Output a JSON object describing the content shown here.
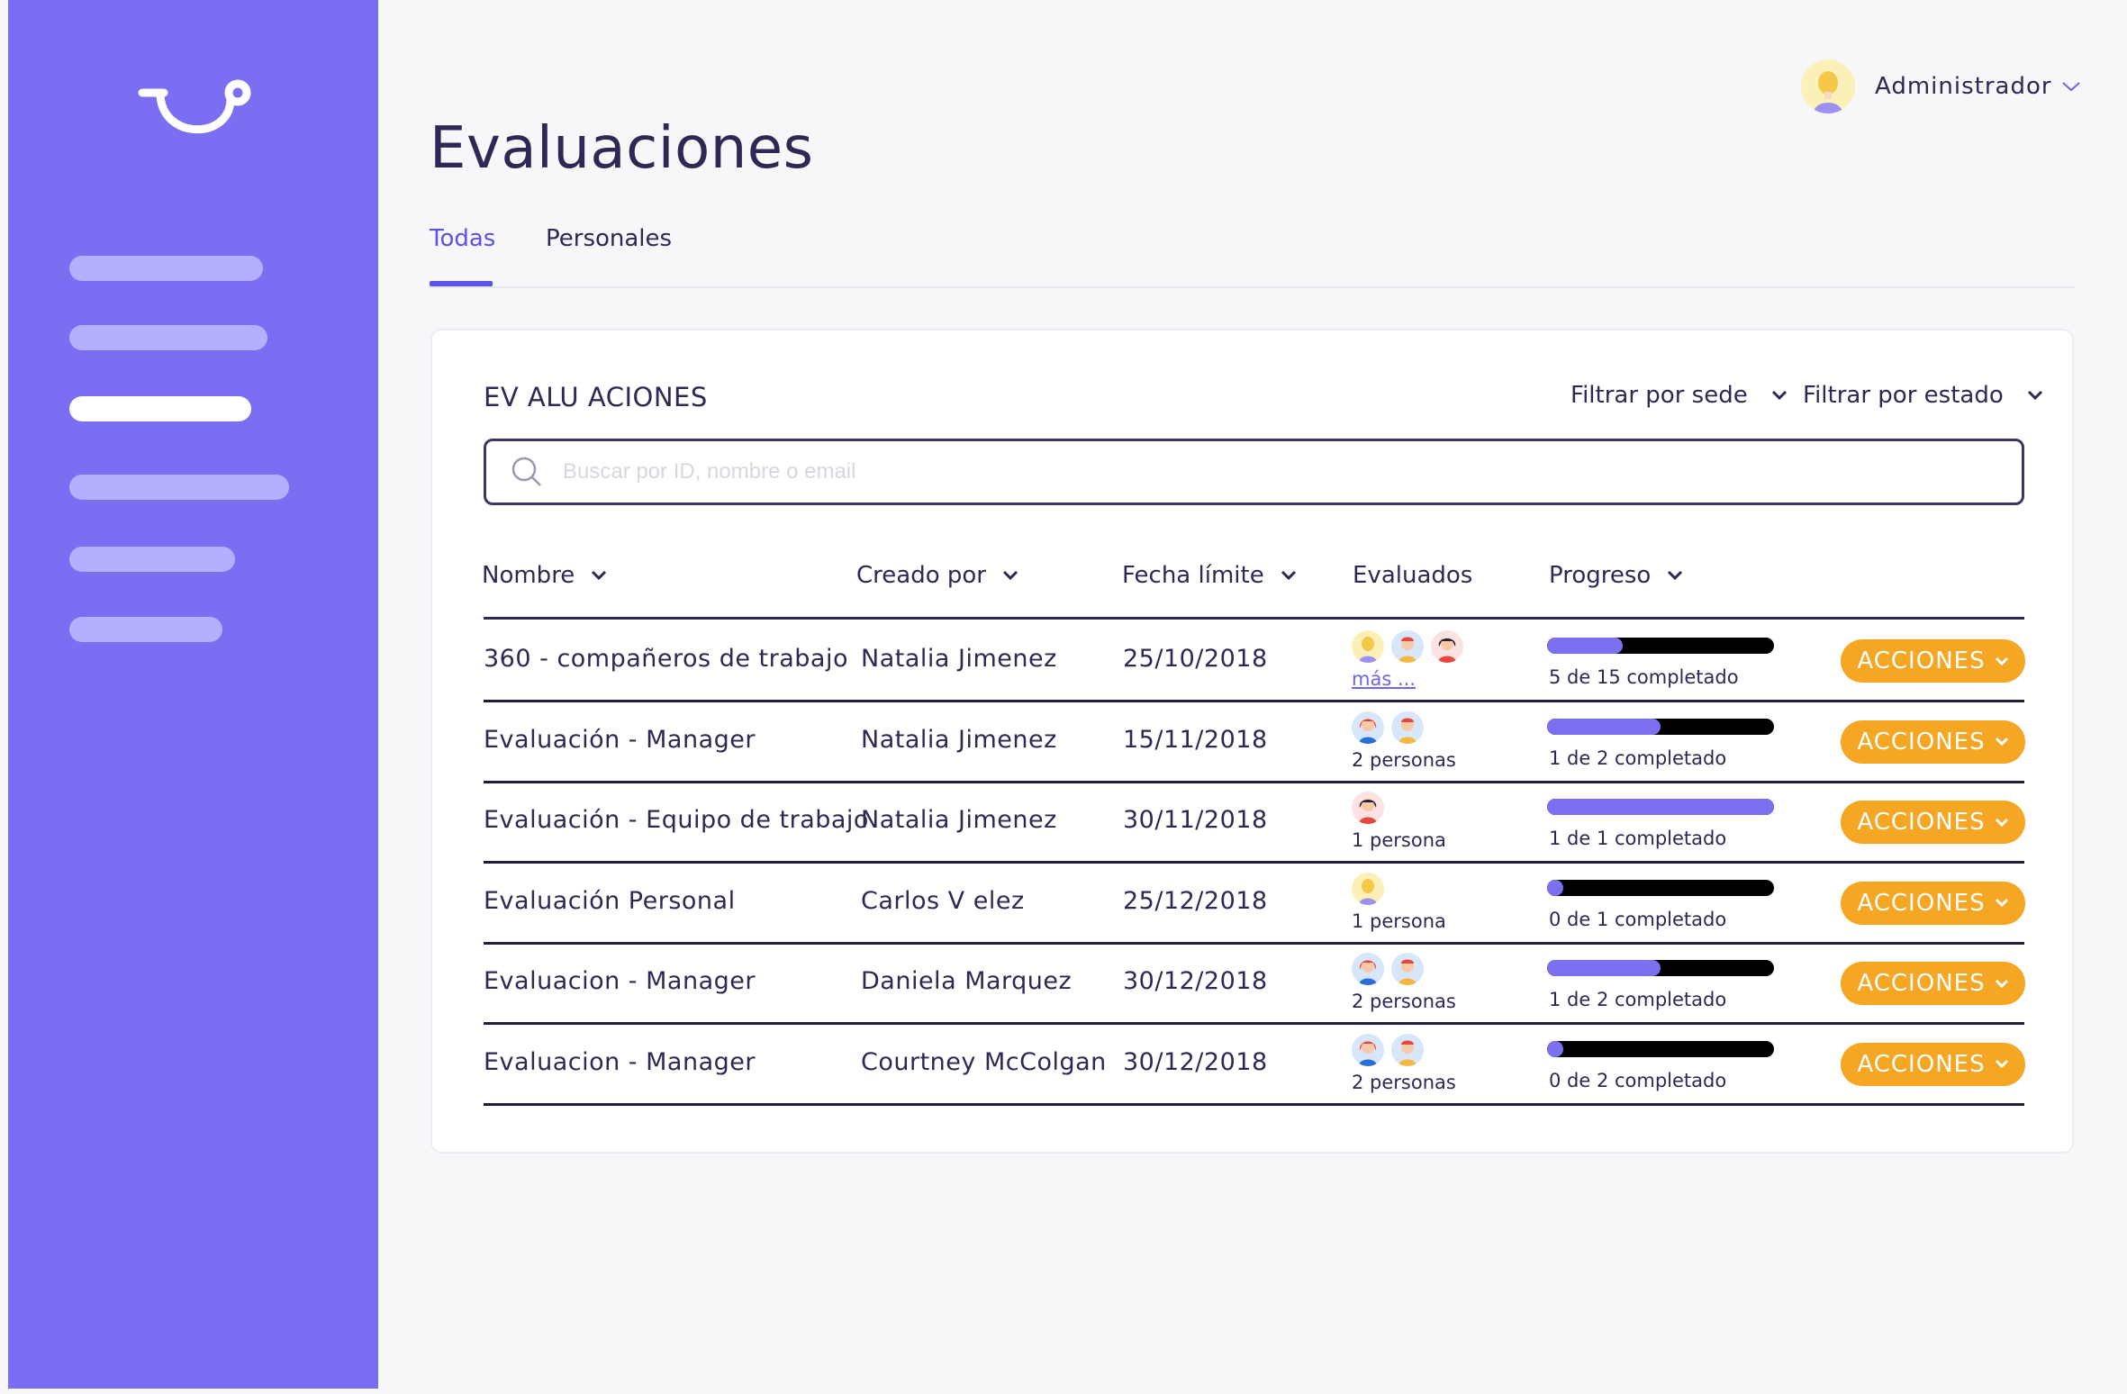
{
  "app": {
    "title": "Evaluaciones",
    "user_name": "Administrador"
  },
  "tabs": [
    {
      "label": "Todas",
      "active": true
    },
    {
      "label": "Personales",
      "active": false
    }
  ],
  "card": {
    "title": "EV ALU ACIONES",
    "filters": [
      "Filtrar por sede",
      "Filtrar por estado"
    ],
    "search_placeholder": "Buscar por ID, nombre o email"
  },
  "columns": [
    "Nombre",
    "Creado por",
    "Fecha límite",
    "Evaluados",
    "Progreso"
  ],
  "rows": [
    {
      "name": "360 - compañeros de trabajo",
      "creator": "Natalia Jimenez",
      "date": "25/10/2018",
      "avatars": [
        "blonde",
        "redhair-man",
        "dark-woman"
      ],
      "evaluated": "más ...",
      "evaluated_link": true,
      "progress_done": 5,
      "progress_total": 15,
      "progress_text": "5 de 15 completado",
      "action": "ACCIONES"
    },
    {
      "name": "Evaluación - Manager",
      "creator": "Natalia Jimenez",
      "date": "15/11/2018",
      "avatars": [
        "red-woman",
        "redhair-man"
      ],
      "evaluated": "2 personas",
      "evaluated_link": false,
      "progress_done": 1,
      "progress_total": 2,
      "progress_text": "1 de 2 completado",
      "action": "ACCIONES"
    },
    {
      "name": "Evaluación - Equipo de trabajo",
      "creator": "Natalia Jimenez",
      "date": "30/11/2018",
      "avatars": [
        "dark-woman"
      ],
      "evaluated": "1 persona",
      "evaluated_link": false,
      "progress_done": 1,
      "progress_total": 1,
      "progress_text": "1 de 1 completado",
      "action": "ACCIONES"
    },
    {
      "name": "Evaluación Personal",
      "creator": "Carlos V  elez",
      "date": "25/12/2018",
      "avatars": [
        "blonde"
      ],
      "evaluated": "1 persona",
      "evaluated_link": false,
      "progress_done": 0,
      "progress_total": 1,
      "progress_text": "0 de 1 completado",
      "action": "ACCIONES"
    },
    {
      "name": "Evaluacion - Manager",
      "creator": "Daniela Marquez",
      "date": "30/12/2018",
      "avatars": [
        "red-woman",
        "redhair-man"
      ],
      "evaluated": "2 personas",
      "evaluated_link": false,
      "progress_done": 1,
      "progress_total": 2,
      "progress_text": "1 de 2 completado",
      "action": "ACCIONES"
    },
    {
      "name": "Evaluacion - Manager",
      "creator": "Courtney McColgan",
      "date": "30/12/2018",
      "avatars": [
        "red-woman",
        "redhair-man"
      ],
      "evaluated": "2 personas",
      "evaluated_link": false,
      "progress_done": 0,
      "progress_total": 2,
      "progress_text": "0 de 2 completado",
      "action": "ACCIONES"
    }
  ],
  "colors": {
    "sidebar": "#7a6ff2",
    "accent": "#5b52e8",
    "progress_fill": "#7b70f0",
    "action_button": "#f5a623"
  },
  "icons": {
    "logo": "smile-logo-icon",
    "search": "search-icon",
    "chevron": "chevron-down-icon"
  }
}
